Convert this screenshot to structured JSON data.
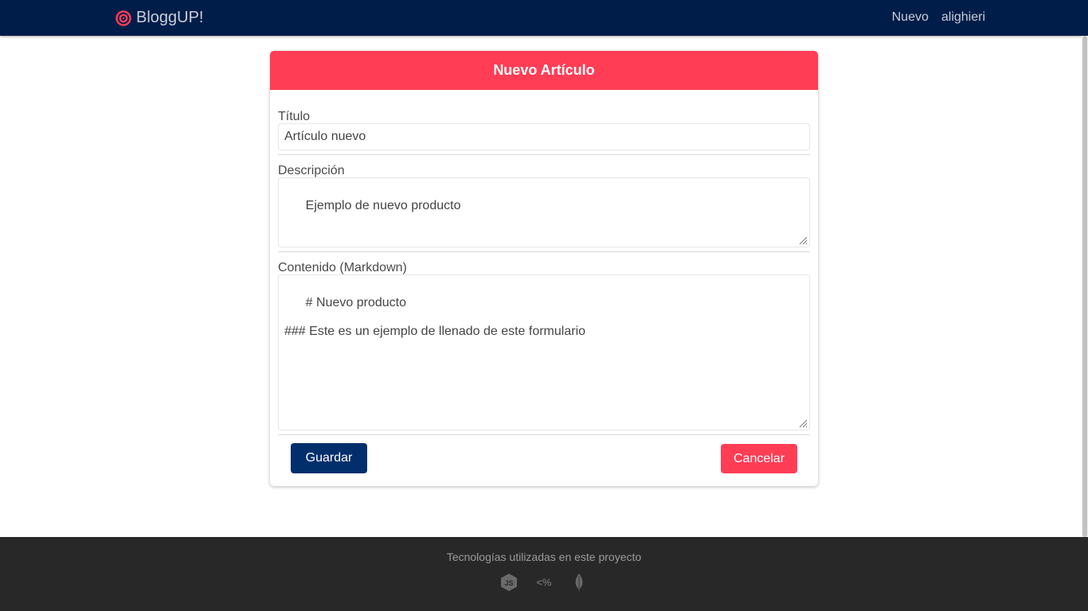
{
  "navbar": {
    "brand": "BloggUP!",
    "links": [
      "Nuevo",
      "alighieri"
    ],
    "brand_icon": "target-icon",
    "background": "#001d4a"
  },
  "form": {
    "title": "Nuevo Artículo",
    "header_color": "#ff3d55",
    "fields": {
      "title": {
        "label": "Título",
        "value": "Artículo nuevo"
      },
      "description": {
        "label": "Descripción",
        "value": "Ejemplo de nuevo producto"
      },
      "content": {
        "label": "Contenido (Markdown)",
        "value": "# Nuevo producto\n\n### Este es un ejemplo de llenado de este formulario"
      }
    },
    "buttons": {
      "save": "Guardar",
      "cancel": "Cancelar"
    },
    "save_color": "#002f6c",
    "cancel_color": "#ff3d55"
  },
  "footer": {
    "text": "Tecnologías utilizadas en este proyecto",
    "icons": [
      "nodejs-icon",
      "ejs-icon",
      "mongodb-icon"
    ],
    "background": "#282828"
  }
}
